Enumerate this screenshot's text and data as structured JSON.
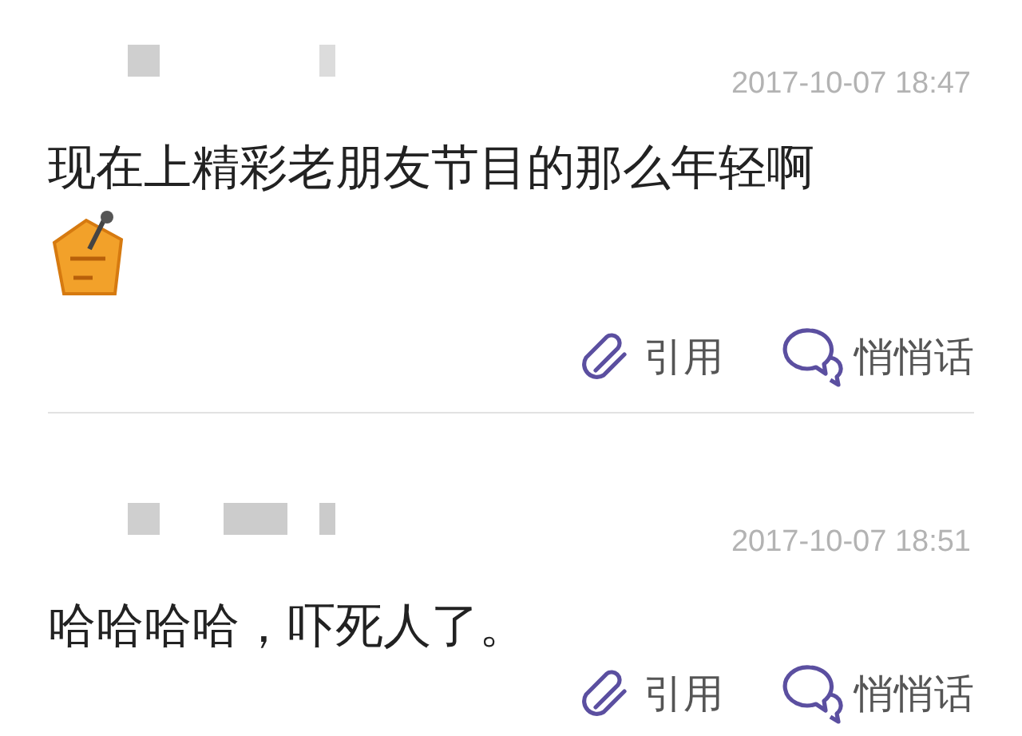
{
  "posts": [
    {
      "time": "2017-10-07 18:47",
      "text": "现在上精彩老朋友节目的那么年轻啊",
      "has_sticker": true,
      "actions": [
        {
          "kind": "quote",
          "label": "引用"
        },
        {
          "kind": "whisper",
          "label": "悄悄话"
        }
      ]
    },
    {
      "time": "2017-10-07 18:51",
      "text": "哈哈哈哈，吓死人了。",
      "has_sticker": false,
      "actions": [
        {
          "kind": "quote",
          "label": "引用"
        },
        {
          "kind": "whisper",
          "label": "悄悄话"
        }
      ]
    }
  ]
}
